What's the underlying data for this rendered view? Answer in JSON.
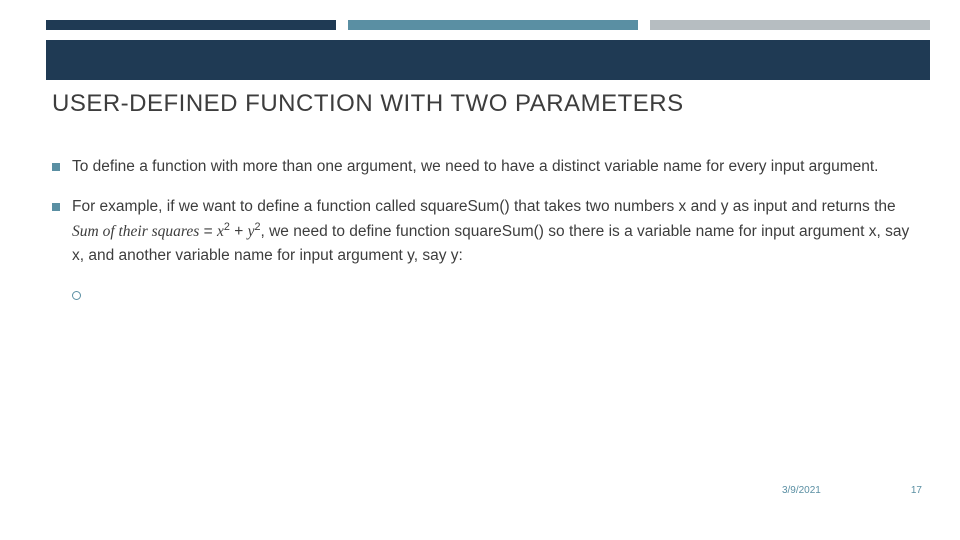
{
  "title": "USER-DEFINED FUNCTION WITH TWO PARAMETERS",
  "bullets": {
    "b1": "To define a function with more than one argument, we need to have a distinct variable name for every input argument.",
    "b2_pre": "For example, if we want to define a function called squareSum() that takes two numbers x and y as input and returns the ",
    "b2_math_lhs": "Sum of their squares",
    "b2_math_eq": " = ",
    "b2_math_x": "x",
    "b2_math_sup1": "2",
    "b2_math_plus": " + ",
    "b2_math_y": "y",
    "b2_math_sup2": "2",
    "b2_post": ", we need to define function squareSum() so there is a variable name for input argument x, say x, and another variable name for input argument y, say y:"
  },
  "footer": {
    "date": "3/9/2021",
    "page": "17"
  }
}
